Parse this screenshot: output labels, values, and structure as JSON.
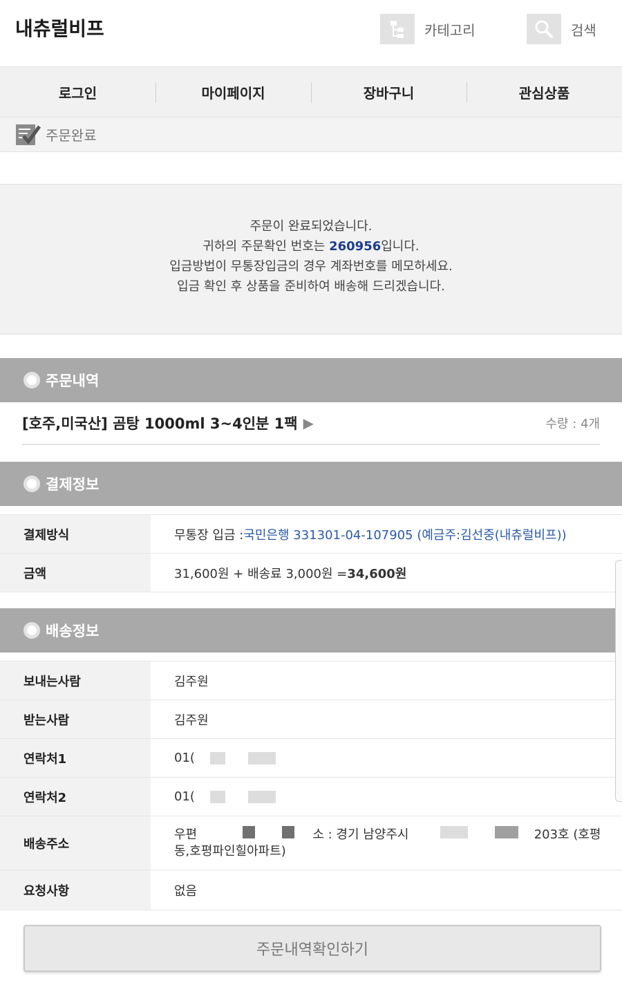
{
  "header": {
    "site_title": "내츄럴비프",
    "category_label": "카테고리",
    "search_label": "검색"
  },
  "nav": {
    "login": "로그인",
    "mypage": "마이페이지",
    "cart": "장바구니",
    "wishlist": "관심상품"
  },
  "breadcrumb": {
    "label": "주문완료"
  },
  "message": {
    "line1": "주문이 완료되었습니다.",
    "line2_pre": "귀하의 주문확인 번호는 ",
    "order_number": "260956",
    "line2_post": "입니다.",
    "line3": "입금방법이 무통장입금의 경우 계좌번호를 메모하세요.",
    "line4": "입금 확인 후 상품을 준비하여 배송해 드리겠습니다."
  },
  "sections": {
    "order": "주문내역",
    "payment": "결제정보",
    "shipping": "배송정보"
  },
  "order_item": {
    "name": "[호주,미국산] 곰탕 1000ml 3~4인분 1팩",
    "arrow": "▶",
    "qty": "수량 : 4개"
  },
  "payment": {
    "method_label": "결제방식",
    "method_pre": "무통장 입금 : ",
    "method_account": "국민은행 331301-04-107905 (예금주:김선중(내츄럴비프))",
    "amount_label": "금액",
    "amount_pre": "31,600원 + 배송료 3,000원 = ",
    "amount_total": "34,600원"
  },
  "shipping": {
    "sender_label": "보내는사람",
    "sender": "김주원",
    "receiver_label": "받는사람",
    "receiver": "김주원",
    "contact1_label": "연락처1",
    "contact1": "01(",
    "contact2_label": "연락처2",
    "contact2": "01(",
    "address_label": "배송주소",
    "address_a": "우편",
    "address_b": "소 : 경기 남양주시",
    "address_c": "203호 (호평",
    "address_d": "동,호평파인힐아파트)",
    "request_label": "요청사항",
    "request": "없음"
  },
  "confirm_button": "주문내역확인하기"
}
